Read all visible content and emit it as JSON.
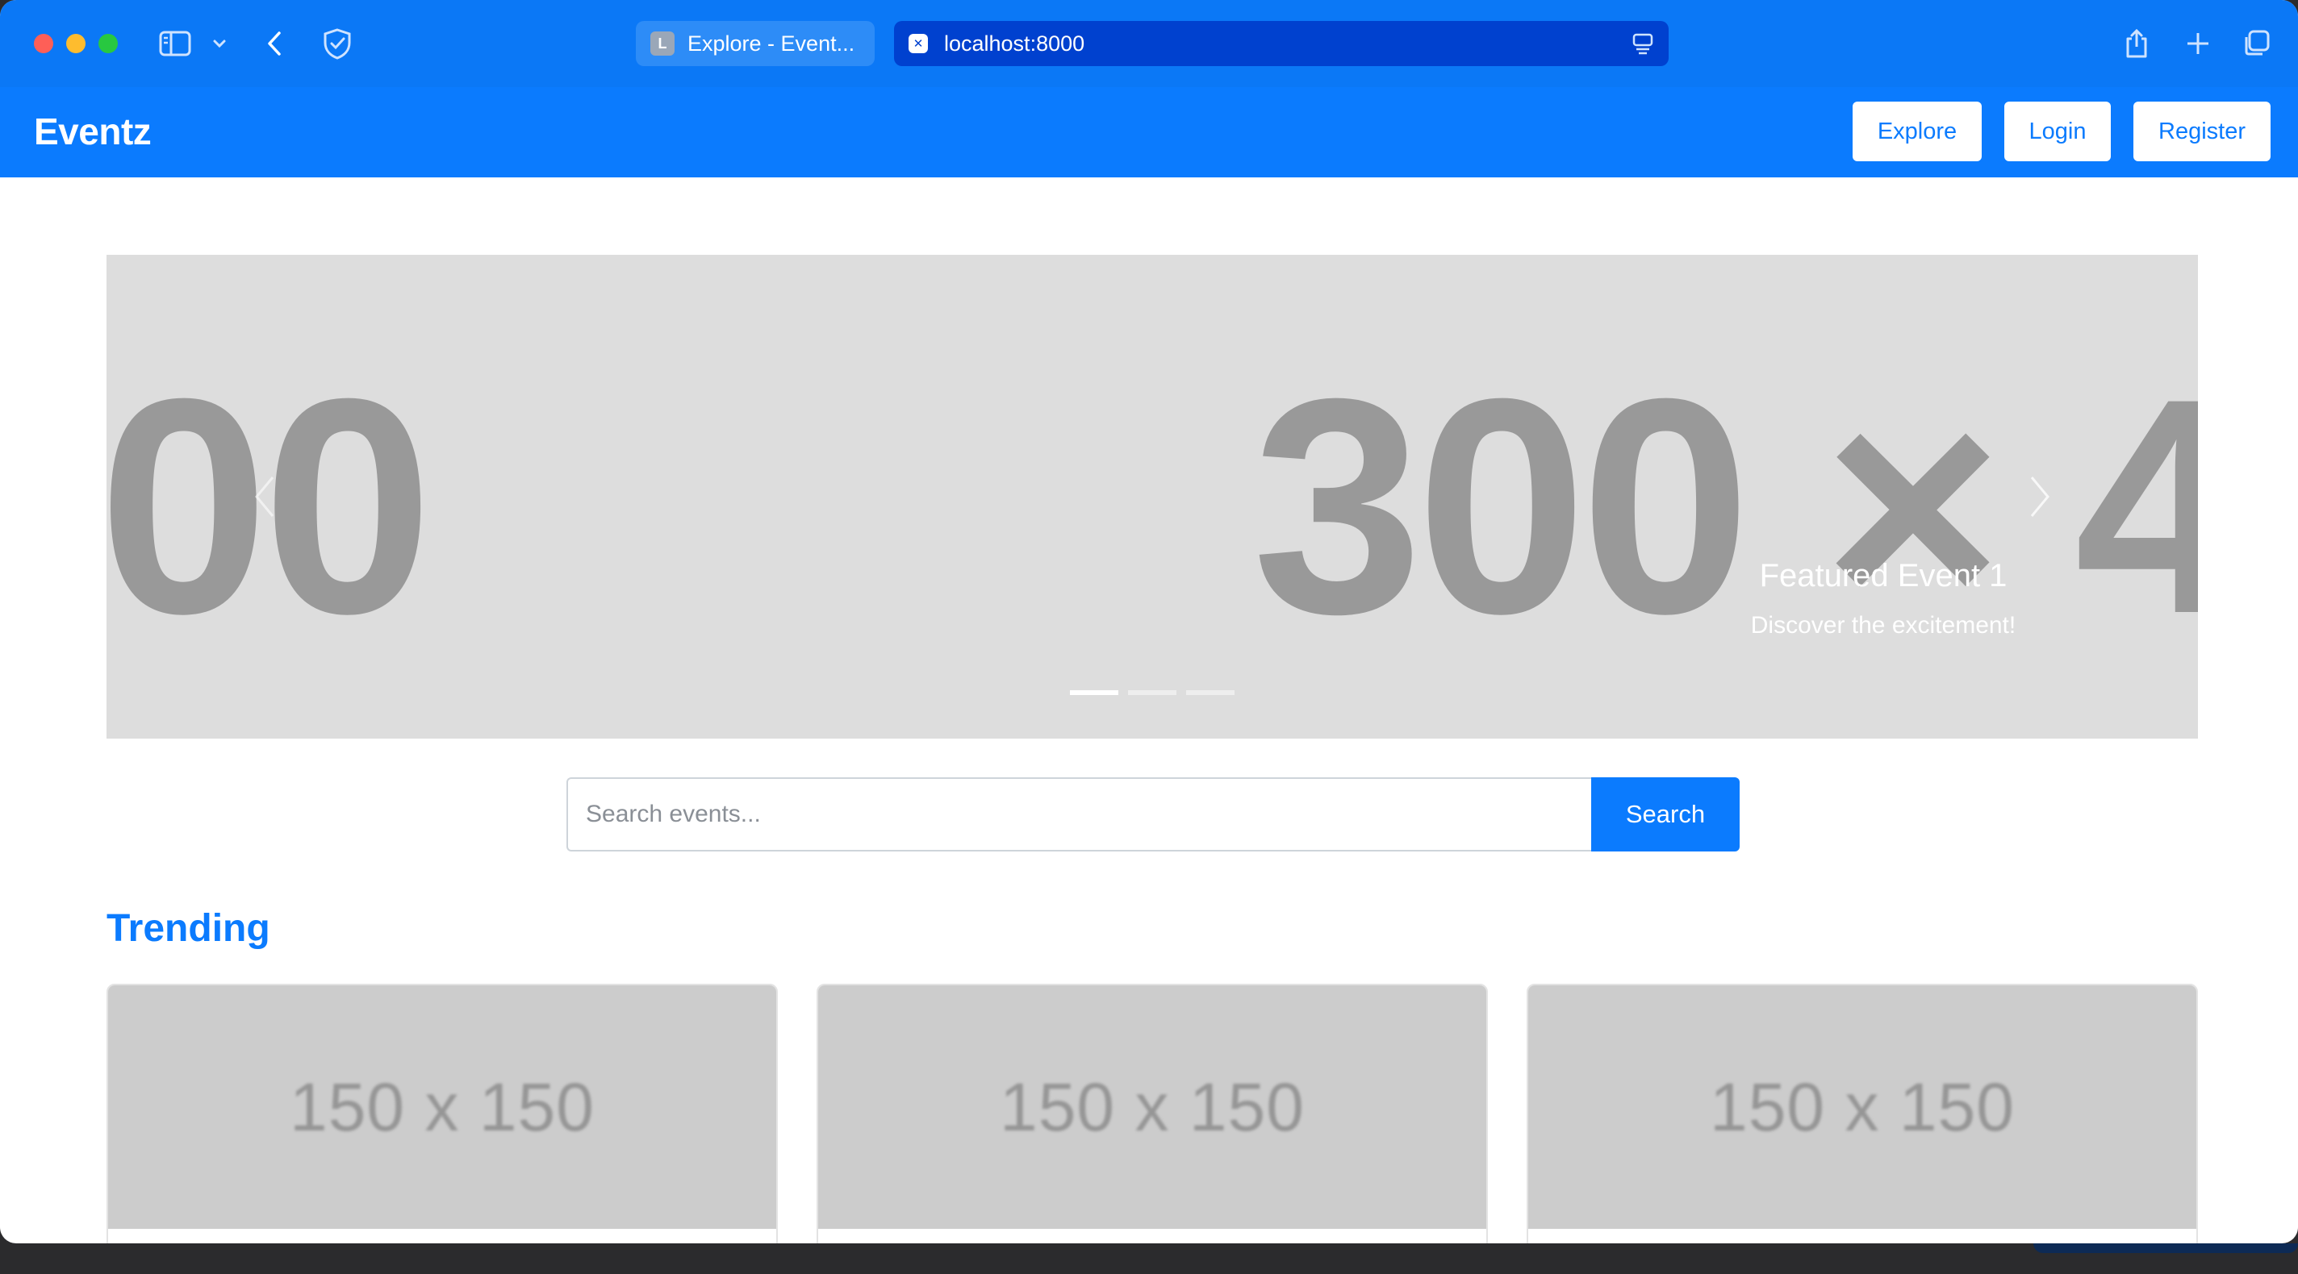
{
  "browser": {
    "tabs": [
      {
        "label": "Explore - Event...",
        "favicon": "L"
      },
      {
        "label": "localhost:8000",
        "favicon": "✕"
      }
    ],
    "icons": [
      "sidebar-icon",
      "chevron-down-icon",
      "back-arrow-icon",
      "shield-check-icon",
      "reader-icon",
      "share-icon",
      "new-tab-icon",
      "tab-overview-icon"
    ]
  },
  "navbar": {
    "brand": "Eventz",
    "buttons": {
      "explore": "Explore",
      "login": "Login",
      "register": "Register"
    }
  },
  "carousel": {
    "placeholder_left": "00",
    "placeholder_right": "300 × 4",
    "caption_title": "Featured Event 1",
    "caption_text": "Discover the excitement!",
    "slide_count": 3,
    "active_slide": 1
  },
  "search": {
    "placeholder": "Search events...",
    "button": "Search"
  },
  "trending": {
    "title": "Trending",
    "cards": [
      {
        "image_text": "150 x 150"
      },
      {
        "image_text": "150 x 150"
      },
      {
        "image_text": "150 x 150"
      }
    ]
  },
  "colors": {
    "primary": "#0b7bfe",
    "chrome": "#0b78f6",
    "placeholder_bg": "#dddddd",
    "card_img_bg": "#cccccc"
  }
}
